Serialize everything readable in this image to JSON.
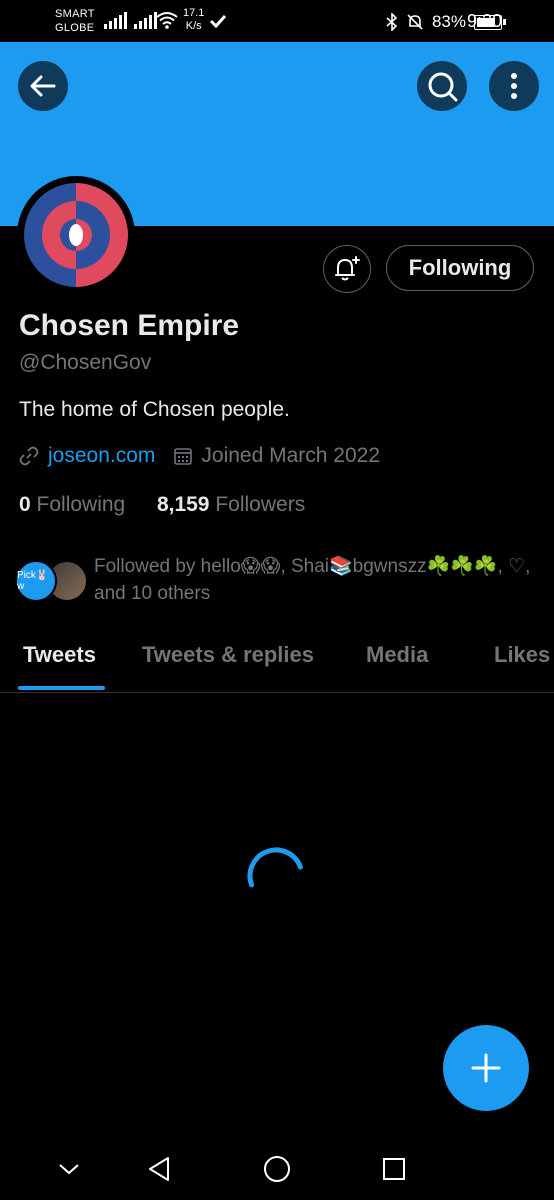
{
  "status_bar": {
    "carrier_line1": "SMART",
    "carrier_line2": "GLOBE",
    "speed_value": "17.1",
    "speed_unit": "K/s",
    "battery_percent": "83%",
    "time": "9:20"
  },
  "profile": {
    "name": "Chosen Empire",
    "handle": "@ChosenGov",
    "bio": "The home of Chosen people.",
    "website": "joseon.com",
    "joined": "Joined March 2022",
    "following_count": "0",
    "following_label": "Following",
    "followers_count": "8,159",
    "followers_label": "Followers",
    "follow_button": "Following",
    "followed_by": "Followed by hello😱😱, Shai📚bgwnszz☘️☘️☘️, ♡, and 10 others",
    "mini_avatar_text": "Pick🐰w"
  },
  "tabs": [
    {
      "label": "Tweets",
      "active": true
    },
    {
      "label": "Tweets & replies",
      "active": false
    },
    {
      "label": "Media",
      "active": false
    },
    {
      "label": "Likes",
      "active": false
    }
  ],
  "colors": {
    "accent": "#1d9bf0",
    "banner": "#1d9bf0",
    "background": "#000000",
    "avatar_red": "#e04a5f",
    "avatar_blue": "#2c4f9e"
  },
  "icons": {
    "back": "back-arrow-icon",
    "search": "search-icon",
    "more": "more-vertical-icon",
    "bell": "bell-plus-icon",
    "link": "link-icon",
    "calendar": "calendar-icon",
    "compose": "plus-icon",
    "nav_down": "chevron-down-icon",
    "nav_back": "triangle-back-icon",
    "nav_home": "circle-home-icon",
    "nav_recent": "square-recents-icon"
  }
}
